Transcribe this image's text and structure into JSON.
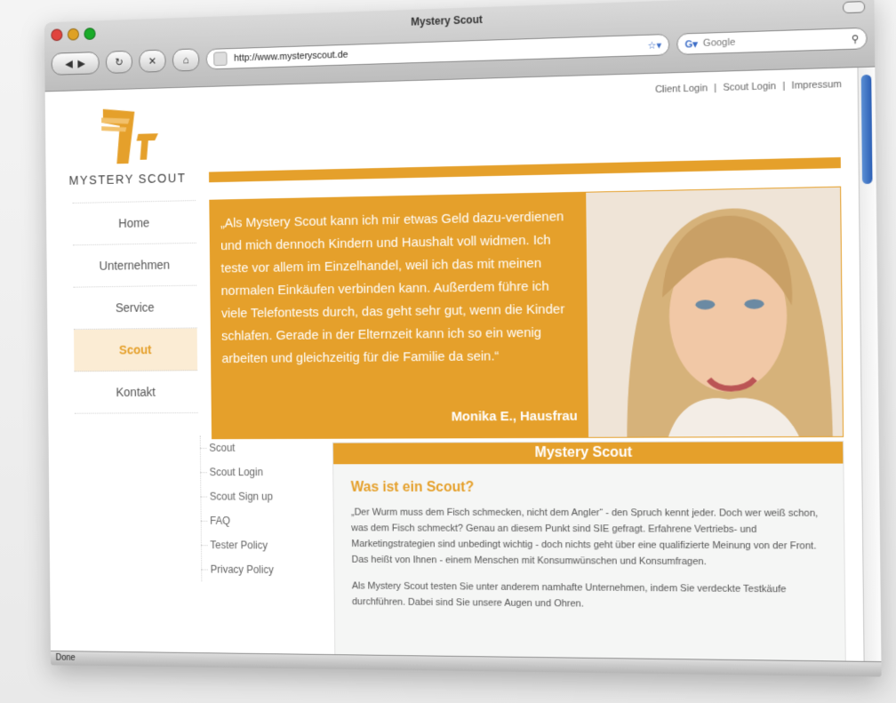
{
  "browser": {
    "window_title": "Mystery Scout",
    "url": "http://www.mysteryscout.de",
    "search_placeholder": "Google",
    "status_text": "Done"
  },
  "site": {
    "brand": "MYSTERY SCOUT",
    "top_links": [
      "Client Login",
      "|",
      "Scout Login",
      "|",
      "Impressum"
    ],
    "main_nav": [
      {
        "label": "Home",
        "active": false
      },
      {
        "label": "Unternehmen",
        "active": false
      },
      {
        "label": "Service",
        "active": false
      },
      {
        "label": "Scout",
        "active": true
      },
      {
        "label": "Kontakt",
        "active": false
      }
    ],
    "hero": {
      "quote": "„Als Mystery Scout kann ich mir etwas Geld dazu-verdienen und mich dennoch Kindern und Haushalt voll widmen. Ich teste vor allem im Einzelhandel, weil ich das mit meinen normalen Einkäufen verbinden kann. Außerdem führe ich viele Telefontests durch, das geht sehr gut, wenn die Kinder schlafen. Gerade in der Elternzeit kann ich so ein wenig arbeiten und gleichzeitig für die Familie da sein.“",
      "author": "Monika E., Hausfrau"
    },
    "sub_nav": [
      "Scout",
      "Scout Login",
      "Scout Sign up",
      "FAQ",
      "Tester Policy",
      "Privacy Policy"
    ],
    "content": {
      "header": "Mystery Scout",
      "title": "Was ist ein Scout?",
      "paragraph1": "„Der Wurm muss dem Fisch schmecken, nicht dem Angler“ - den Spruch kennt jeder. Doch wer weiß schon, was dem Fisch schmeckt? Genau an diesem Punkt sind SIE gefragt. Erfahrene Vertriebs- und Marketingstrategien sind unbedingt wichtig - doch nichts geht über eine qualifizierte Meinung von der Front. Das heißt von Ihnen - einem Menschen mit Konsumwünschen und Konsumfragen.",
      "paragraph2": "Als Mystery Scout testen Sie unter anderem namhafte Unternehmen, indem Sie verdeckte Testkäufe durchführen. Dabei sind Sie unsere Augen und Ohren."
    }
  },
  "colors": {
    "orange": "#e5a02b",
    "active_bg": "#fbecd4"
  }
}
